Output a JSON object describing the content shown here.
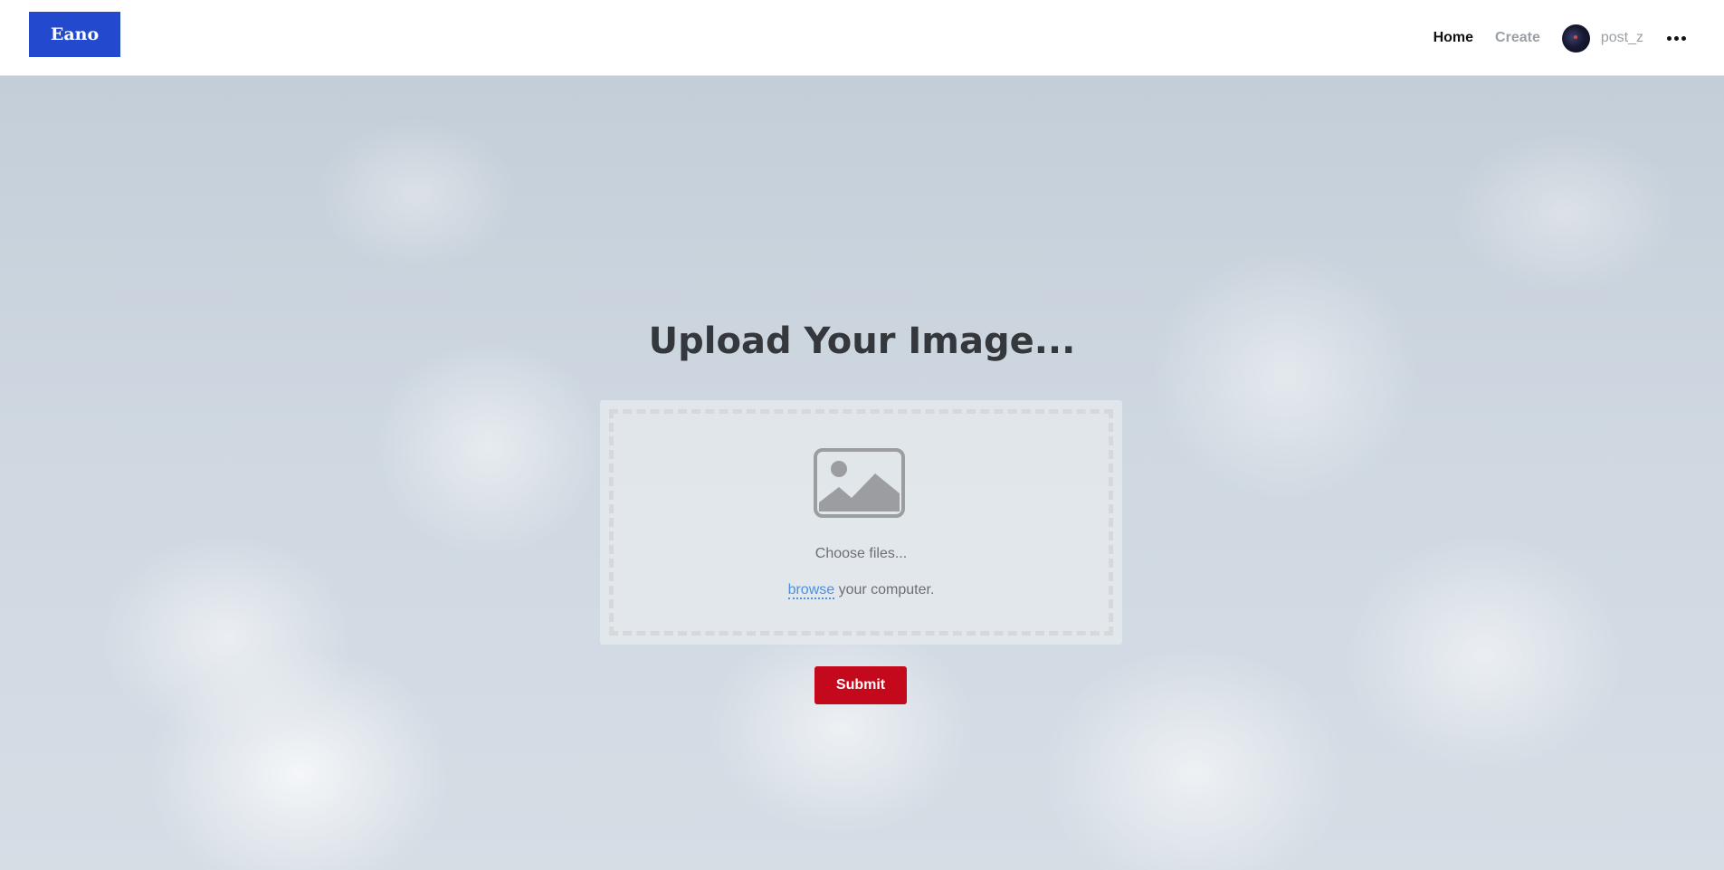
{
  "navbar": {
    "logo": "Eano",
    "links": {
      "home": "Home",
      "create": "Create"
    },
    "username": "post_z",
    "menu_icon": "more-horizontal-icon"
  },
  "main": {
    "title": "Upload Your Image...",
    "upload": {
      "icon": "image-icon",
      "choose_text": "Choose files...",
      "browse_link": "browse",
      "browse_suffix": " your computer."
    },
    "submit_label": "Submit"
  },
  "colors": {
    "logo_bg": "#2349cf",
    "submit_bg": "#c4091d",
    "browse_link": "#4d90e0",
    "title": "#34373b"
  }
}
